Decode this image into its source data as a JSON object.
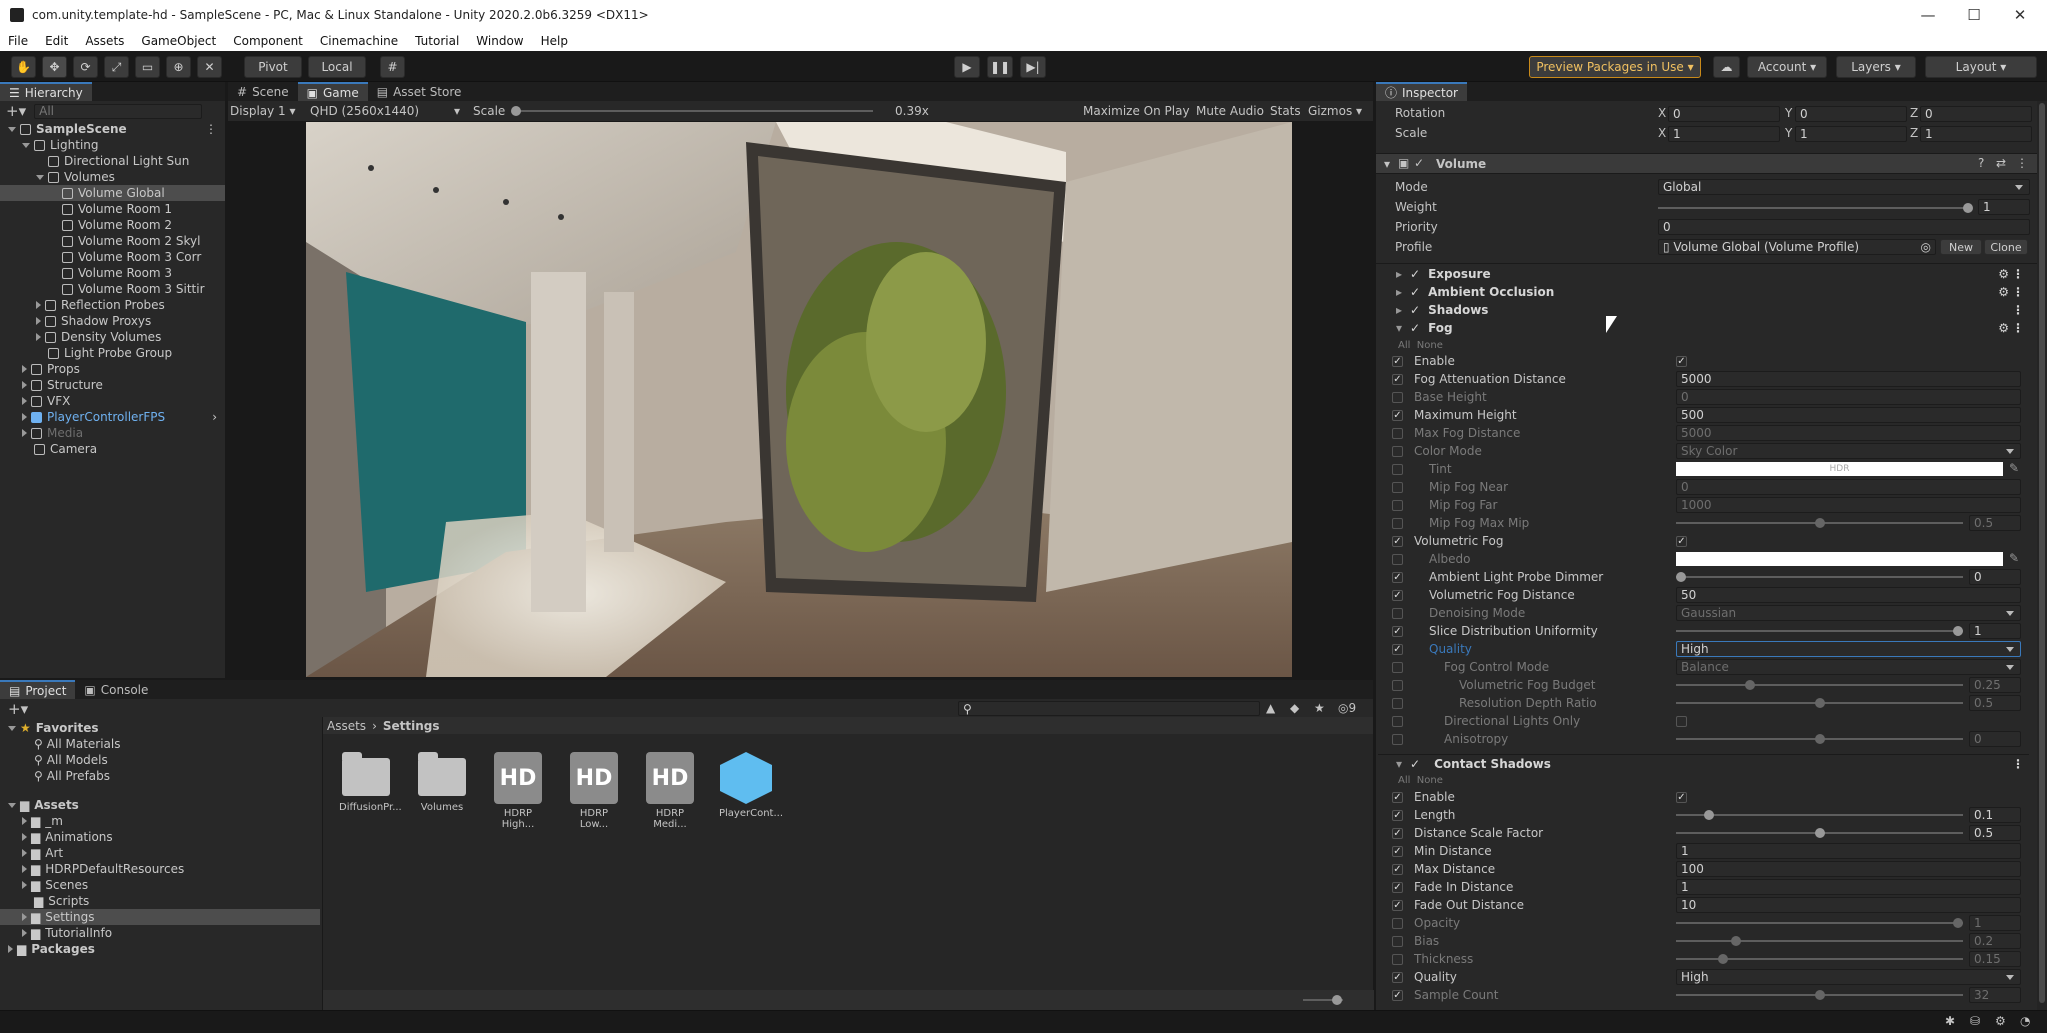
{
  "window": {
    "title": "com.unity.template-hd - SampleScene - PC, Mac & Linux Standalone - Unity 2020.2.0b6.3259 <DX11>"
  },
  "menu": [
    "File",
    "Edit",
    "Assets",
    "GameObject",
    "Component",
    "Cinemachine",
    "Tutorial",
    "Window",
    "Help"
  ],
  "toolbar": {
    "pivot": "Pivot",
    "local": "Local",
    "preview_packages": "Preview Packages in Use",
    "account": "Account",
    "layers": "Layers",
    "layout": "Layout"
  },
  "hierarchy": {
    "tab": "Hierarchy",
    "search_placeholder": "All",
    "items": [
      {
        "label": "SampleScene",
        "indent": 0,
        "type": "scene",
        "expanded": true
      },
      {
        "label": "Lighting",
        "indent": 1,
        "expanded": true
      },
      {
        "label": "Directional Light Sun",
        "indent": 2
      },
      {
        "label": "Volumes",
        "indent": 2,
        "expanded": true
      },
      {
        "label": "Volume Global",
        "indent": 3,
        "selected": true
      },
      {
        "label": "Volume Room 1",
        "indent": 3
      },
      {
        "label": "Volume Room 2",
        "indent": 3
      },
      {
        "label": "Volume Room 2 Skyl",
        "indent": 3
      },
      {
        "label": "Volume Room 3 Corr",
        "indent": 3
      },
      {
        "label": "Volume Room 3",
        "indent": 3
      },
      {
        "label": "Volume Room 3 Sittir",
        "indent": 3
      },
      {
        "label": "Reflection Probes",
        "indent": 2,
        "collapsed": true
      },
      {
        "label": "Shadow Proxys",
        "indent": 2,
        "collapsed": true
      },
      {
        "label": "Density Volumes",
        "indent": 2,
        "collapsed": true
      },
      {
        "label": "Light Probe Group",
        "indent": 2
      },
      {
        "label": "Props",
        "indent": 1,
        "collapsed": true
      },
      {
        "label": "Structure",
        "indent": 1,
        "collapsed": true
      },
      {
        "label": "VFX",
        "indent": 1,
        "collapsed": true
      },
      {
        "label": "PlayerControllerFPS",
        "indent": 1,
        "collapsed": true,
        "prefab": true
      },
      {
        "label": "Media",
        "indent": 1,
        "collapsed": true,
        "dim": true
      },
      {
        "label": "Camera",
        "indent": 1
      }
    ]
  },
  "sceneview": {
    "tabs": [
      "Scene",
      "Game",
      "Asset Store"
    ],
    "display": "Display 1",
    "resolution": "QHD (2560x1440)",
    "scale_label": "Scale",
    "scale_value": "0.39x",
    "maximize": "Maximize On Play",
    "mute": "Mute Audio",
    "stats": "Stats",
    "gizmos": "Gizmos"
  },
  "project": {
    "tabs": [
      "Project",
      "Console"
    ],
    "hidden_count": "9",
    "favorites": {
      "label": "Favorites",
      "items": [
        "All Materials",
        "All Models",
        "All Prefabs"
      ]
    },
    "assets": {
      "label": "Assets",
      "items": [
        "_m",
        "Animations",
        "Art",
        "HDRPDefaultResources",
        "Scenes",
        "Scripts",
        "Settings",
        "TutorialInfo"
      ]
    },
    "packages": "Packages",
    "breadcrumb": [
      "Assets",
      "Settings"
    ],
    "files": [
      {
        "name": "DiffusionPr...",
        "kind": "folder"
      },
      {
        "name": "Volumes",
        "kind": "folder"
      },
      {
        "name": "HDRP High...",
        "kind": "hd"
      },
      {
        "name": "HDRP Low...",
        "kind": "hd"
      },
      {
        "name": "HDRP Medi...",
        "kind": "hd"
      },
      {
        "name": "PlayerCont...",
        "kind": "prefab"
      }
    ],
    "hd_badge": "HD"
  },
  "inspector": {
    "tab": "Inspector",
    "transform": {
      "rotation": {
        "label": "Rotation",
        "x": "0",
        "y": "0",
        "z": "0"
      },
      "scale": {
        "label": "Scale",
        "x": "1",
        "y": "1",
        "z": "1"
      },
      "axis": {
        "x": "X",
        "y": "Y",
        "z": "Z"
      }
    },
    "volume": {
      "title": "Volume",
      "mode": {
        "label": "Mode",
        "value": "Global"
      },
      "weight": {
        "label": "Weight",
        "value": "1",
        "fraction": 1.0
      },
      "priority": {
        "label": "Priority",
        "value": "0"
      },
      "profile": {
        "label": "Profile",
        "value": "Volume Global (Volume Profile)",
        "new": "New",
        "clone": "Clone"
      }
    },
    "overrides": [
      "Exposure",
      "Ambient Occlusion",
      "Shadows",
      "Fog"
    ],
    "all_none": {
      "all": "All",
      "none": "None"
    },
    "fog_rows": [
      {
        "label": "Enable",
        "override": true,
        "kind": "toggle",
        "value": true,
        "indent": 0
      },
      {
        "label": "Fog Attenuation Distance",
        "override": true,
        "kind": "text",
        "value": "5000",
        "indent": 0
      },
      {
        "label": "Base Height",
        "override": false,
        "kind": "text",
        "value": "0",
        "indent": 0
      },
      {
        "label": "Maximum Height",
        "override": true,
        "kind": "text",
        "value": "500",
        "indent": 0
      },
      {
        "label": "Max Fog Distance",
        "override": false,
        "kind": "text",
        "value": "5000",
        "indent": 0
      },
      {
        "label": "Color Mode",
        "override": false,
        "kind": "dropdown",
        "value": "Sky Color",
        "indent": 0
      },
      {
        "label": "Tint",
        "override": false,
        "kind": "color",
        "value": "HDR",
        "indent": 1
      },
      {
        "label": "Mip Fog Near",
        "override": false,
        "kind": "text",
        "value": "0",
        "indent": 1
      },
      {
        "label": "Mip Fog Far",
        "override": false,
        "kind": "text",
        "value": "1000",
        "indent": 1
      },
      {
        "label": "Mip Fog Max Mip",
        "override": false,
        "kind": "slider",
        "value": "0.5",
        "fraction": 0.5,
        "indent": 1
      },
      {
        "label": "Volumetric Fog",
        "override": true,
        "kind": "toggle",
        "value": true,
        "indent": 0
      },
      {
        "label": "Albedo",
        "override": false,
        "kind": "color",
        "value": "",
        "indent": 1
      },
      {
        "label": "Ambient Light Probe Dimmer",
        "override": true,
        "kind": "slider",
        "value": "0",
        "fraction": 0.0,
        "indent": 1
      },
      {
        "label": "Volumetric Fog Distance",
        "override": true,
        "kind": "text",
        "value": "50",
        "indent": 1
      },
      {
        "label": "Denoising Mode",
        "override": false,
        "kind": "dropdown",
        "value": "Gaussian",
        "indent": 1
      },
      {
        "label": "Slice Distribution Uniformity",
        "override": true,
        "kind": "slider",
        "value": "1",
        "fraction": 1.0,
        "indent": 1
      },
      {
        "label": "Quality",
        "override": true,
        "kind": "dropdown",
        "value": "High",
        "indent": 1,
        "active": true
      },
      {
        "label": "Fog Control Mode",
        "override": false,
        "kind": "dropdown",
        "value": "Balance",
        "indent": 2
      },
      {
        "label": "Volumetric Fog Budget",
        "override": false,
        "kind": "slider",
        "value": "0.25",
        "fraction": 0.25,
        "indent": 3
      },
      {
        "label": "Resolution Depth Ratio",
        "override": false,
        "kind": "slider",
        "value": "0.5",
        "fraction": 0.5,
        "indent": 3
      },
      {
        "label": "Directional Lights Only",
        "override": false,
        "kind": "toggle",
        "value": false,
        "indent": 2
      },
      {
        "label": "Anisotropy",
        "override": false,
        "kind": "slider",
        "value": "0",
        "fraction": 0.5,
        "indent": 2
      }
    ],
    "contact_shadows": {
      "title": "Contact Shadows",
      "rows": [
        {
          "label": "Enable",
          "override": true,
          "kind": "toggle",
          "value": true
        },
        {
          "label": "Length",
          "override": true,
          "kind": "slider",
          "value": "0.1",
          "fraction": 0.1
        },
        {
          "label": "Distance Scale Factor",
          "override": true,
          "kind": "slider",
          "value": "0.5",
          "fraction": 0.5
        },
        {
          "label": "Min Distance",
          "override": true,
          "kind": "text",
          "value": "1"
        },
        {
          "label": "Max Distance",
          "override": true,
          "kind": "text",
          "value": "100"
        },
        {
          "label": "Fade In Distance",
          "override": true,
          "kind": "text",
          "value": "1"
        },
        {
          "label": "Fade Out Distance",
          "override": true,
          "kind": "text",
          "value": "10"
        },
        {
          "label": "Opacity",
          "override": false,
          "kind": "slider",
          "value": "1",
          "fraction": 1.0
        },
        {
          "label": "Bias",
          "override": false,
          "kind": "slider",
          "value": "0.2",
          "fraction": 0.2
        },
        {
          "label": "Thickness",
          "override": false,
          "kind": "slider",
          "value": "0.15",
          "fraction": 0.15
        },
        {
          "label": "Quality",
          "override": true,
          "kind": "dropdown",
          "value": "High"
        },
        {
          "label": "Sample Count",
          "override": true,
          "kind": "slider",
          "value": "32",
          "fraction": 0.5,
          "dim": true
        }
      ]
    }
  },
  "colors": {
    "accent": "#3a79bb",
    "preview_border": "#c98a1a",
    "prefab": "#6fb1f0"
  }
}
